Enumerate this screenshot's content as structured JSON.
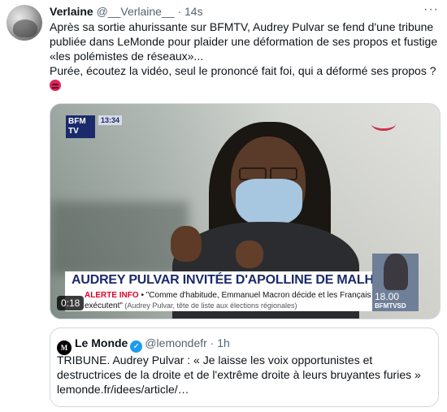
{
  "tweet": {
    "display_name": "Verlaine",
    "handle": "@__Verlaine__",
    "separator": "·",
    "time": "14s",
    "more_label": "···",
    "text_line1": "Après sa sortie ahurissante sur BFMTV, Audrey Pulvar se fend d'une tribune publiée dans LeMonde pour plaider une déformation de ses propos et fustige «les polémistes de réseaux»...",
    "text_line2": "Purée, écoutez la vidéo, seul le prononcé fait foi, qui a déformé ses propos ?",
    "emoji": "angry-face-emoji"
  },
  "video": {
    "channel_logo": "BFM TV",
    "channel_time": "13:34",
    "headline": "AUDREY PULVAR INVITÉE D'APOLLINE DE MALHERBE",
    "ticker_label": "ALERTE INFO",
    "ticker_quote": " • \"Comme d'habitude, Emmanuel Macron décide et les Français exécutent\"",
    "ticker_source": " (Audrey Pulvar, tête de liste aux élections régionales)",
    "side_time": "18.00",
    "side_label": "BFMTVSD",
    "duration": "0:18"
  },
  "quote": {
    "avatar_text": "M",
    "name": "Le Monde",
    "verified_icon": "verified-badge-icon",
    "handle": "@lemondefr",
    "separator": "·",
    "time": "1h",
    "text": "TRIBUNE. Audrey Pulvar : « Je laisse les voix opportunistes et destructrices de la droite et de l'extrême droite à leurs bruyantes furies » lemonde.fr/idees/article/…"
  },
  "colors": {
    "text_primary": "#0f1419",
    "text_secondary": "#536471",
    "border": "#cfd9de",
    "verified": "#1d9bf0",
    "alerte": "#e4002b",
    "bfm_blue": "#1b2a6b"
  }
}
